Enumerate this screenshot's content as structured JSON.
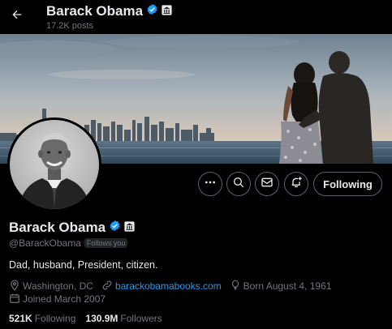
{
  "header": {
    "title": "Barack Obama",
    "posts_count": "17.2K posts"
  },
  "profile": {
    "name": "Barack Obama",
    "handle": "@BarackObama",
    "follows_you_badge": "Follows you",
    "bio": "Dad, husband, President, citizen.",
    "location": "Washington, DC",
    "website": "barackobamabooks.com",
    "birthday": "Born August 4, 1961",
    "joined": "Joined March 2007",
    "following_count": "521K",
    "following_label": "Following",
    "followers_count": "130.9M",
    "followers_label": "Followers"
  },
  "actions": {
    "follow_state_label": "Following"
  },
  "icons": {
    "back": "arrow-left-icon",
    "verified": "verified-badge-icon",
    "government": "government-affiliation-icon",
    "more": "more-icon",
    "search": "search-icon",
    "message": "mail-icon",
    "notify": "bell-plus-icon",
    "location": "location-pin-icon",
    "link": "link-icon",
    "birthday": "balloon-icon",
    "calendar": "calendar-icon"
  },
  "colors": {
    "background": "#000000",
    "text_primary": "#e7e9ea",
    "text_secondary": "#71767b",
    "accent": "#1d9bf0",
    "border": "#536471"
  }
}
